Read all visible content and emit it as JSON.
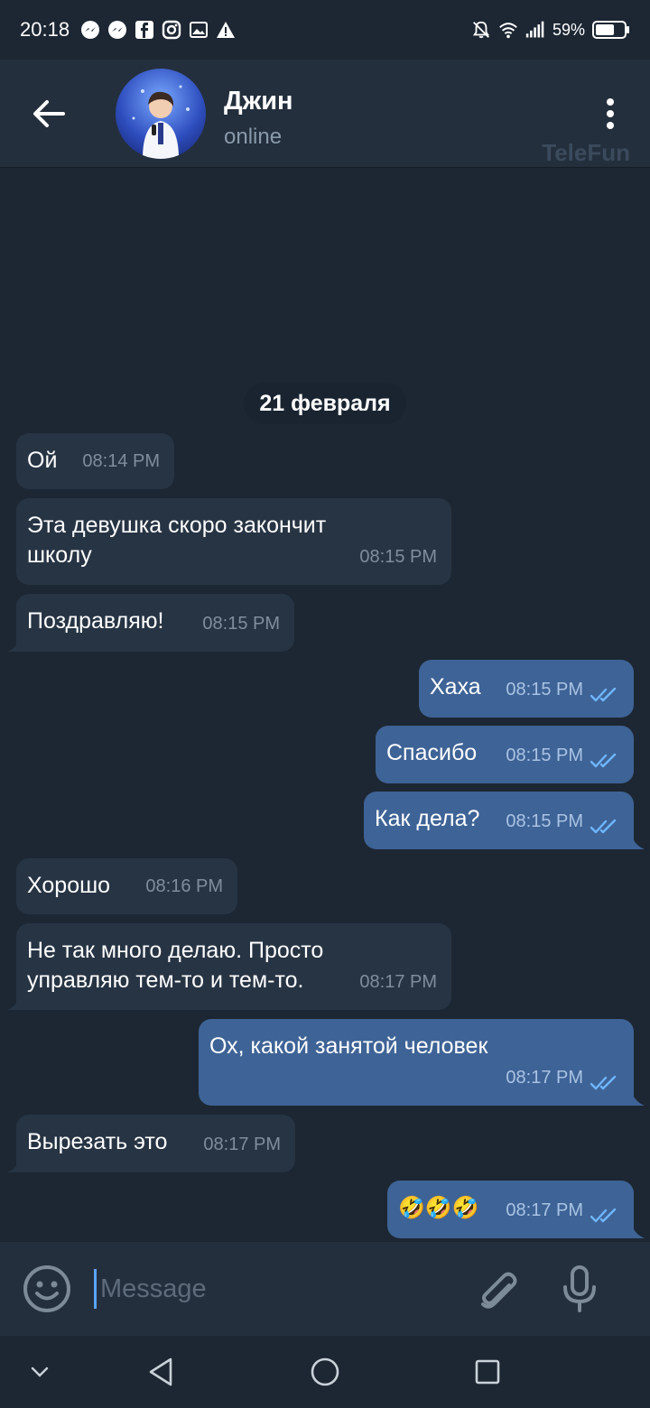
{
  "status_bar": {
    "time": "20:18",
    "battery": "59%",
    "left_icons": [
      "messenger-icon",
      "messenger-icon",
      "facebook-icon",
      "instagram-icon",
      "gallery-icon",
      "warning-icon"
    ],
    "right_icons": [
      "mute-icon",
      "wifi-icon",
      "signal-icon",
      "battery-icon"
    ]
  },
  "header": {
    "name": "Джин",
    "status": "online",
    "watermark": "TeleFun"
  },
  "date_chip": "21 февраля",
  "messages": [
    {
      "dir": "in",
      "text": "Ой",
      "time": "08:14 PM"
    },
    {
      "dir": "in",
      "text": "Эта девушка скоро закончит школу",
      "time": "08:15 PM"
    },
    {
      "dir": "in",
      "text": "Поздравляю!",
      "time": "08:15 PM"
    },
    {
      "dir": "out",
      "text": "Хаха",
      "time": "08:15 PM",
      "read": true
    },
    {
      "dir": "out",
      "text": "Спасибо",
      "time": "08:15 PM",
      "read": true
    },
    {
      "dir": "out",
      "text": "Как дела?",
      "time": "08:15 PM",
      "read": true
    },
    {
      "dir": "in",
      "text": "Хорошо",
      "time": "08:16 PM"
    },
    {
      "dir": "in",
      "text": "Не так много делаю. Просто управляю тем-то и тем-то.",
      "time": "08:17 PM"
    },
    {
      "dir": "out",
      "text": "Ох, какой занятой человек",
      "time": "08:17 PM",
      "read": true
    },
    {
      "dir": "in",
      "text": "Вырезать это",
      "time": "08:17 PM"
    },
    {
      "dir": "out",
      "text": "🤣🤣🤣",
      "time": "08:17 PM",
      "read": true
    }
  ],
  "composer": {
    "placeholder": "Message"
  },
  "colors": {
    "background": "#1d2733",
    "header": "#242f3d",
    "incoming_bubble": "#273444",
    "outgoing_bubble": "#3e6396",
    "check": "#6fb6ff"
  }
}
